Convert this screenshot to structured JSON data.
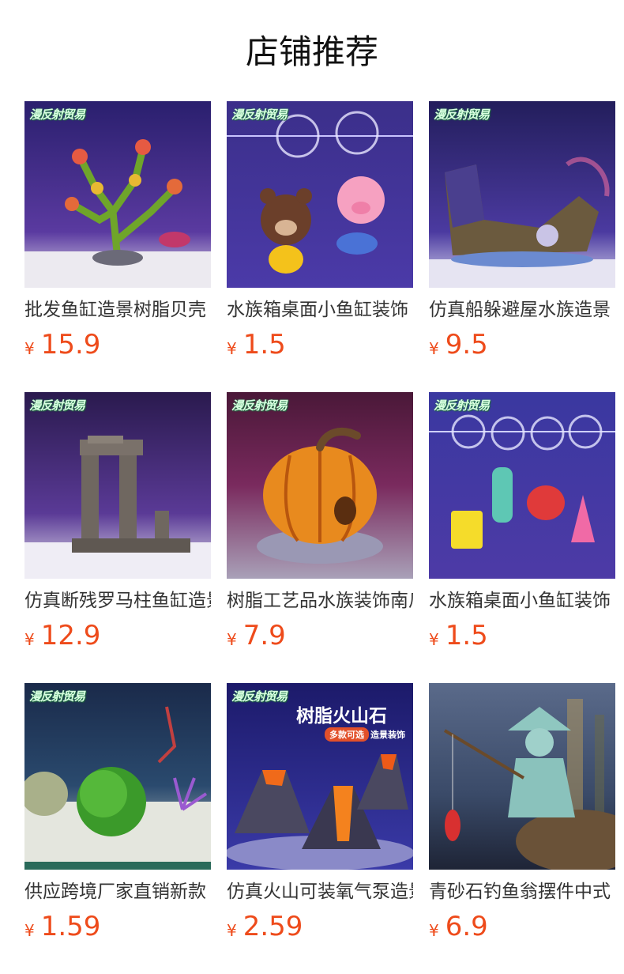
{
  "shop": {
    "title": "店铺推荐"
  },
  "colors": {
    "price": "#ee4b1b",
    "title": "#111111",
    "name": "#333333"
  },
  "products": [
    {
      "name": "批发鱼缸造景树脂贝壳",
      "currency": "¥",
      "price": "15.9",
      "watermark": "漫反射贸易",
      "image": "orange-coral-ornament"
    },
    {
      "name": "水族箱桌面小鱼缸装饰",
      "currency": "¥",
      "price": "1.5",
      "watermark": "漫反射贸易",
      "image": "bear-pig-float-ornament"
    },
    {
      "name": "仿真船躲避屋水族造景",
      "currency": "¥",
      "price": "9.5",
      "watermark": "漫反射贸易",
      "image": "shipwreck-ornament"
    },
    {
      "name": "仿真断残罗马柱鱼缸造景",
      "currency": "¥",
      "price": "12.9",
      "watermark": "漫反射贸易",
      "image": "roman-column-ornament"
    },
    {
      "name": "树脂工艺品水族装饰南瓜",
      "currency": "¥",
      "price": "7.9",
      "watermark": "漫反射贸易",
      "image": "pumpkin-house-ornament"
    },
    {
      "name": "水族箱桌面小鱼缸装饰",
      "currency": "¥",
      "price": "1.5",
      "watermark": "漫反射贸易",
      "image": "cartoon-float-ornament"
    },
    {
      "name": "供应跨境厂家直销新款",
      "currency": "¥",
      "price": "1.59",
      "watermark": "漫反射贸易",
      "image": "moss-ball-plant"
    },
    {
      "name": "仿真火山可装氧气泵造景",
      "currency": "¥",
      "price": "2.59",
      "watermark": "漫反射贸易",
      "image": "volcano-ornament",
      "banner": {
        "title": "树脂火山石",
        "badge": "多款可选",
        "tag": "造景装饰"
      }
    },
    {
      "name": "青砂石钓鱼翁摆件中式",
      "currency": "¥",
      "price": "6.9",
      "watermark": "",
      "image": "fisherman-figurine"
    }
  ]
}
